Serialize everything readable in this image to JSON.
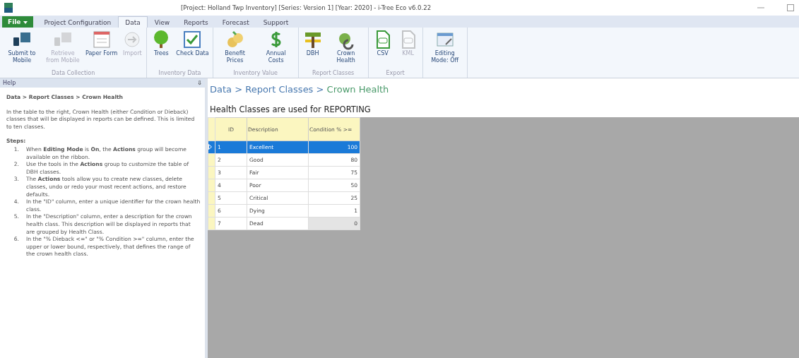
{
  "window": {
    "title": "[Project: Holland Twp Inventory] [Series: Version 1] [Year: 2020] - i-Tree Eco v6.0.22"
  },
  "file_button": "File",
  "tabs": [
    {
      "label": "Project Configuration",
      "selected": false
    },
    {
      "label": "Data",
      "selected": true
    },
    {
      "label": "View",
      "selected": false
    },
    {
      "label": "Reports",
      "selected": false
    },
    {
      "label": "Forecast",
      "selected": false
    },
    {
      "label": "Support",
      "selected": false
    }
  ],
  "ribbon_groups": [
    {
      "label": "Data Collection",
      "buttons": [
        {
          "label": "Submit to Mobile",
          "kind": "mobile",
          "disabled": false
        },
        {
          "label": "Retrieve from Mobile",
          "kind": "mobile",
          "disabled": true
        },
        {
          "label": "Paper Form",
          "kind": "form",
          "disabled": false
        },
        {
          "label": "Import",
          "kind": "import",
          "disabled": true
        }
      ]
    },
    {
      "label": "Inventory Data",
      "buttons": [
        {
          "label": "Trees",
          "kind": "tree",
          "disabled": false
        },
        {
          "label": "Check Data",
          "kind": "check",
          "disabled": false
        }
      ]
    },
    {
      "label": "Inventory Value",
      "buttons": [
        {
          "label": "Benefit Prices",
          "kind": "prices",
          "disabled": false
        },
        {
          "label": "Annual Costs",
          "kind": "dollar",
          "disabled": false
        }
      ]
    },
    {
      "label": "Report Classes",
      "buttons": [
        {
          "label": "DBH",
          "kind": "dbh",
          "disabled": false
        },
        {
          "label": "Crown Health",
          "kind": "crown",
          "disabled": false
        }
      ]
    },
    {
      "label": "Export",
      "buttons": [
        {
          "label": "CSV",
          "kind": "file",
          "disabled": false
        },
        {
          "label": "KML",
          "kind": "file",
          "disabled": true
        }
      ]
    },
    {
      "buttons": [
        {
          "label": "Editing Mode: Off",
          "kind": "edit",
          "disabled": false
        }
      ]
    }
  ],
  "help": {
    "title": "Help",
    "pin": "⇩",
    "heading": "Data > Report Classes > Crown Health",
    "intro": "In the table to the right, Crown Health (either Condition or Dieback) classes that will be displayed in reports can be defined. This is limited to ten classes.",
    "steps_label": "Steps:",
    "steps": [
      {
        "number": "1.",
        "text": "When **Editing Mode** is **On**, the **Actions** group will become available on the ribbon."
      },
      {
        "number": "2.",
        "text": "Use the tools in the **Actions** group to customize the table of DBH classes."
      },
      {
        "number": "3.",
        "text": "The **Actions** tools allow you to create new classes, delete classes, undo or redo your most recent actions, and restore defaults."
      },
      {
        "number": "4.",
        "text": "In the \"ID\" column, enter a unique identifier for the crown health class."
      },
      {
        "number": "5.",
        "text": "In the \"Description\" column, enter a description for the crown health class. This description will be displayed in reports that are grouped by Health Class."
      },
      {
        "number": "6.",
        "text": "In the \"% Dieback <=\" or \"% Condition >=\" column, enter the upper or lower bound, respectively, that defines the range of the crown health class."
      }
    ]
  },
  "breadcrumb": {
    "path": "Data > Report Classes > ",
    "current": "Crown Health"
  },
  "table_title": "Health Classes are used for REPORTING",
  "table": {
    "columns": [
      "ID",
      "Description",
      "Condition % >="
    ],
    "rows": [
      {
        "cells": [
          "1",
          "Excellent",
          "100"
        ],
        "selected": true,
        "locked": false
      },
      {
        "cells": [
          "2",
          "Good",
          "80"
        ],
        "selected": false,
        "locked": false
      },
      {
        "cells": [
          "3",
          "Fair",
          "75"
        ],
        "selected": false,
        "locked": false
      },
      {
        "cells": [
          "4",
          "Poor",
          "50"
        ],
        "selected": false,
        "locked": false
      },
      {
        "cells": [
          "5",
          "Critical",
          "25"
        ],
        "selected": false,
        "locked": false
      },
      {
        "cells": [
          "6",
          "Dying",
          "1"
        ],
        "selected": false,
        "locked": false
      },
      {
        "cells": [
          "7",
          "Dead",
          "0"
        ],
        "selected": false,
        "locked": true
      }
    ]
  }
}
